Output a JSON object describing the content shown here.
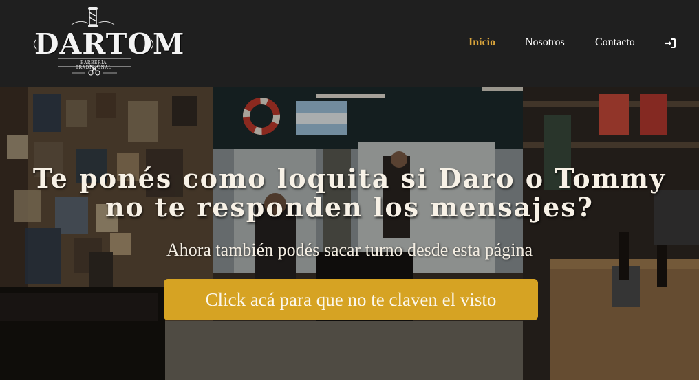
{
  "brand": {
    "name": "DARTOM",
    "tagline": "BARBERIA TRADICIONAL"
  },
  "nav": {
    "items": [
      {
        "label": "Inicio",
        "active": true
      },
      {
        "label": "Nosotros",
        "active": false
      },
      {
        "label": "Contacto",
        "active": false
      }
    ],
    "login_icon": "sign-in-icon"
  },
  "hero": {
    "title_line1": "Te ponés como loquita si Daro o Tommy",
    "title_line2": "no te responden los mensajes?",
    "subtitle": "Ahora también podés sacar turno desde esta página",
    "cta_label": "Click acá para que no te claven el visto"
  },
  "colors": {
    "navbar_bg": "#1f1f1f",
    "active_link": "#d8a33b",
    "cta_bg": "#d6a323",
    "text_light": "#ffffff"
  }
}
